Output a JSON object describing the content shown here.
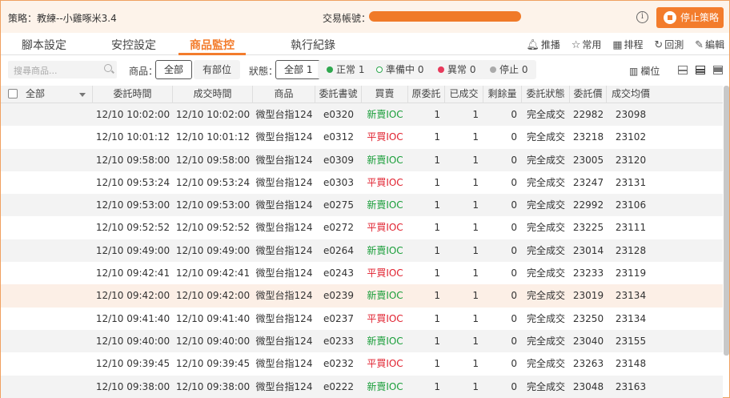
{
  "header": {
    "strategy_label": "策略：",
    "strategy_name": "教練--小雞啄米3.4",
    "account_label": "交易帳號：",
    "stop_label": "停止策略"
  },
  "tabs": [
    {
      "label": "腳本設定"
    },
    {
      "label": "安控設定"
    },
    {
      "label": "商品監控"
    },
    {
      "label": "執行紀錄"
    }
  ],
  "toolbar": {
    "push": "推播",
    "favorite": "常用",
    "schedule": "排程",
    "backtest": "回測",
    "edit": "編輯"
  },
  "filters": {
    "search_placeholder": "搜尋商品...",
    "product_label": "商品：",
    "product_all": "全部",
    "product_has_position": "有部位",
    "status_label": "狀態：",
    "status_all": "全部 1",
    "status_normal": "正常 1",
    "status_preparing": "準備中 0",
    "status_error": "異常 0",
    "status_stopped": "停止 0",
    "columns_label": "欄位"
  },
  "colors": {
    "accent": "#f37c2c",
    "buy": "#1a9e3a",
    "sell": "#e0202e",
    "normal_dot": "#2fa84f",
    "preparing_dot": "#2fa84f",
    "error_dot": "#e83a5c",
    "stopped_dot": "#aaaaaa"
  },
  "table": {
    "select_all": "全部",
    "columns": [
      "委託時間",
      "成交時間",
      "商品",
      "委託書號",
      "買賣",
      "原委託",
      "已成交",
      "剩餘量",
      "委託狀態",
      "委託價",
      "成交均價"
    ],
    "rows": [
      {
        "order_time": "12/10 10:02:00",
        "fill_time": "12/10 10:02:00",
        "product": "微型台指124",
        "order_no": "e0320",
        "side": "新賣IOC",
        "side_type": "buy",
        "orig": "1",
        "filled": "1",
        "remain": "0",
        "status": "完全成交",
        "price": "22982",
        "avg": "23098"
      },
      {
        "order_time": "12/10 10:01:12",
        "fill_time": "12/10 10:01:12",
        "product": "微型台指124",
        "order_no": "e0312",
        "side": "平買IOC",
        "side_type": "sell",
        "orig": "1",
        "filled": "1",
        "remain": "0",
        "status": "完全成交",
        "price": "23218",
        "avg": "23102"
      },
      {
        "order_time": "12/10 09:58:00",
        "fill_time": "12/10 09:58:00",
        "product": "微型台指124",
        "order_no": "e0309",
        "side": "新賣IOC",
        "side_type": "buy",
        "orig": "1",
        "filled": "1",
        "remain": "0",
        "status": "完全成交",
        "price": "23005",
        "avg": "23120"
      },
      {
        "order_time": "12/10 09:53:24",
        "fill_time": "12/10 09:53:24",
        "product": "微型台指124",
        "order_no": "e0303",
        "side": "平買IOC",
        "side_type": "sell",
        "orig": "1",
        "filled": "1",
        "remain": "0",
        "status": "完全成交",
        "price": "23247",
        "avg": "23131"
      },
      {
        "order_time": "12/10 09:53:00",
        "fill_time": "12/10 09:53:00",
        "product": "微型台指124",
        "order_no": "e0275",
        "side": "新賣IOC",
        "side_type": "buy",
        "orig": "1",
        "filled": "1",
        "remain": "0",
        "status": "完全成交",
        "price": "22992",
        "avg": "23106"
      },
      {
        "order_time": "12/10 09:52:52",
        "fill_time": "12/10 09:52:52",
        "product": "微型台指124",
        "order_no": "e0272",
        "side": "平買IOC",
        "side_type": "sell",
        "orig": "1",
        "filled": "1",
        "remain": "0",
        "status": "完全成交",
        "price": "23225",
        "avg": "23111"
      },
      {
        "order_time": "12/10 09:49:00",
        "fill_time": "12/10 09:49:00",
        "product": "微型台指124",
        "order_no": "e0264",
        "side": "新賣IOC",
        "side_type": "buy",
        "orig": "1",
        "filled": "1",
        "remain": "0",
        "status": "完全成交",
        "price": "23014",
        "avg": "23128"
      },
      {
        "order_time": "12/10 09:42:41",
        "fill_time": "12/10 09:42:41",
        "product": "微型台指124",
        "order_no": "e0243",
        "side": "平買IOC",
        "side_type": "sell",
        "orig": "1",
        "filled": "1",
        "remain": "0",
        "status": "完全成交",
        "price": "23233",
        "avg": "23119"
      },
      {
        "order_time": "12/10 09:42:00",
        "fill_time": "12/10 09:42:00",
        "product": "微型台指124",
        "order_no": "e0239",
        "side": "新賣IOC",
        "side_type": "buy",
        "orig": "1",
        "filled": "1",
        "remain": "0",
        "status": "完全成交",
        "price": "23019",
        "avg": "23134",
        "highlight": true
      },
      {
        "order_time": "12/10 09:41:40",
        "fill_time": "12/10 09:41:40",
        "product": "微型台指124",
        "order_no": "e0237",
        "side": "平買IOC",
        "side_type": "sell",
        "orig": "1",
        "filled": "1",
        "remain": "0",
        "status": "完全成交",
        "price": "23250",
        "avg": "23134"
      },
      {
        "order_time": "12/10 09:40:00",
        "fill_time": "12/10 09:40:00",
        "product": "微型台指124",
        "order_no": "e0233",
        "side": "新賣IOC",
        "side_type": "buy",
        "orig": "1",
        "filled": "1",
        "remain": "0",
        "status": "完全成交",
        "price": "23040",
        "avg": "23155"
      },
      {
        "order_time": "12/10 09:39:45",
        "fill_time": "12/10 09:39:45",
        "product": "微型台指124",
        "order_no": "e0232",
        "side": "平買IOC",
        "side_type": "sell",
        "orig": "1",
        "filled": "1",
        "remain": "0",
        "status": "完全成交",
        "price": "23263",
        "avg": "23148"
      },
      {
        "order_time": "12/10 09:38:00",
        "fill_time": "12/10 09:38:00",
        "product": "微型台指124",
        "order_no": "e0222",
        "side": "新賣IOC",
        "side_type": "buy",
        "orig": "1",
        "filled": "1",
        "remain": "0",
        "status": "完全成交",
        "price": "23048",
        "avg": "23163"
      }
    ]
  }
}
